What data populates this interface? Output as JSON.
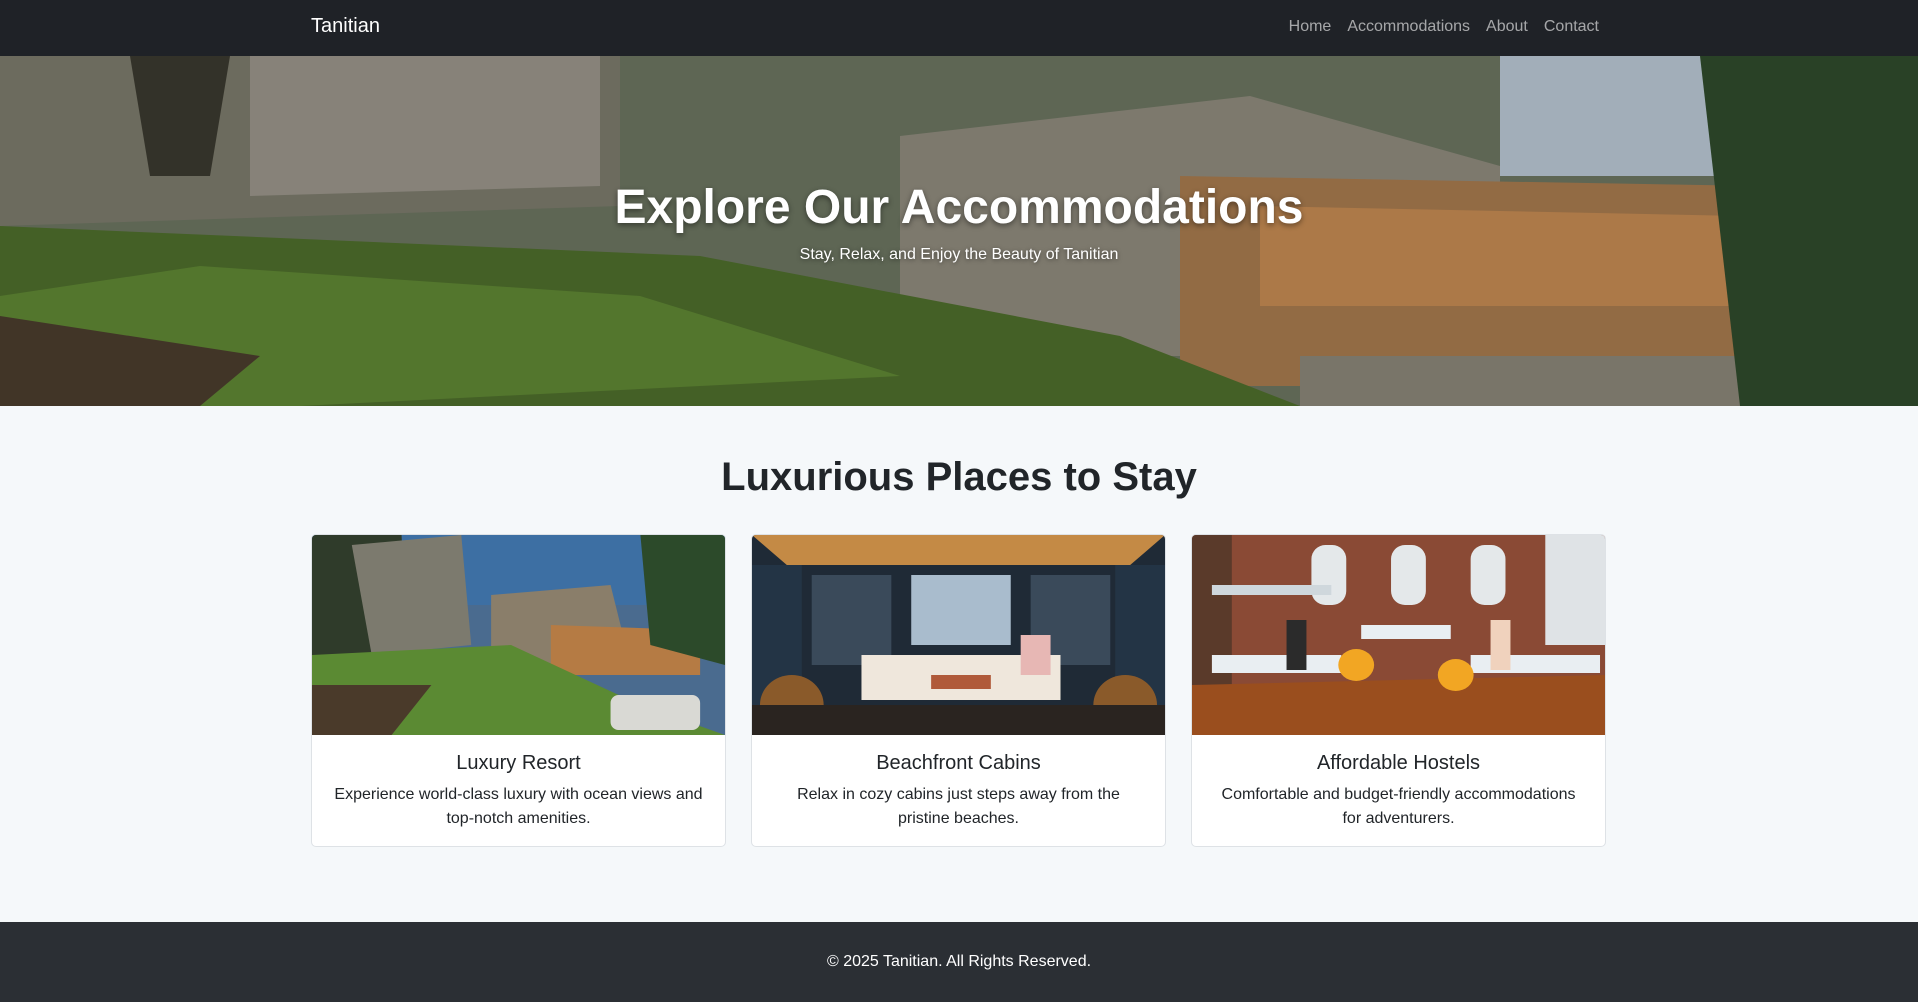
{
  "navbar": {
    "brand": "Tanitian",
    "links": [
      "Home",
      "Accommodations",
      "About",
      "Contact"
    ]
  },
  "hero": {
    "title": "Explore Our Accommodations",
    "subtitle": "Stay, Relax, and Enjoy the Beauty of Tanitian"
  },
  "section": {
    "title": "Luxurious Places to Stay",
    "cards": [
      {
        "title": "Luxury Resort",
        "text": "Experience world-class luxury with ocean views and top-notch amenities."
      },
      {
        "title": "Beachfront Cabins",
        "text": "Relax in cozy cabins just steps away from the pristine beaches."
      },
      {
        "title": "Affordable Hostels",
        "text": "Comfortable and budget-friendly accommodations for adventurers."
      }
    ]
  },
  "footer": {
    "text": "© 2025 Tanitian. All Rights Reserved."
  },
  "colors": {
    "navbar_bg": "#1f2227",
    "footer_bg": "#2b2f34",
    "page_bg": "#f5f8fa"
  }
}
